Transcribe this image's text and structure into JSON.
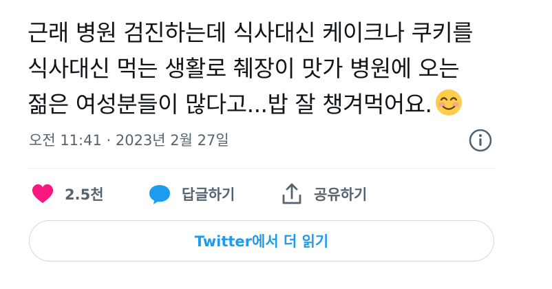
{
  "tweet": {
    "text_lines": [
      "근래 병원 검진하는데 식사대신 케이크나 쿠키를",
      "식사대신 먹는 생활로 췌장이 맛가 병원에 오는",
      "젊은 여성분들이 많다고...밥 잘 챙겨먹어요."
    ],
    "emoji": "smiling-face-with-smiling-eyes",
    "timestamp": "오전 11:41 · 2023년 2월 27일"
  },
  "actions": {
    "like_count": "2.5천",
    "reply_label": "답글하기",
    "share_label": "공유하기"
  },
  "read_more_label": "Twitter에서 더 읽기",
  "colors": {
    "text": "#0f1419",
    "muted": "#536471",
    "like": "#f91880",
    "reply": "#1d9bf0",
    "link": "#1d9bf0",
    "border": "#cfd9de"
  }
}
